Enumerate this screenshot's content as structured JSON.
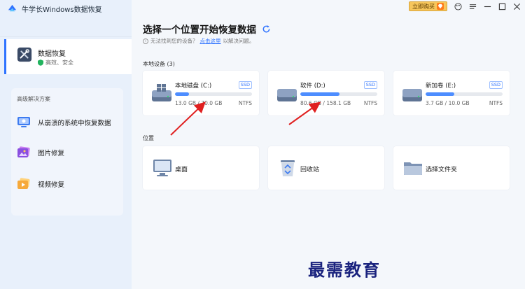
{
  "app": {
    "title": "牛学长Windows数据恢复"
  },
  "sidebar": {
    "active_item": {
      "label": "数据恢复",
      "sub": "高效、安全"
    },
    "advanced": {
      "title": "高级解决方案",
      "items": [
        {
          "label": "从崩溃的系统中恢复数据",
          "icon": "monitor-rescue-icon"
        },
        {
          "label": "图片修复",
          "icon": "photo-repair-icon"
        },
        {
          "label": "视频修复",
          "icon": "video-repair-icon"
        }
      ]
    }
  },
  "titlebar": {
    "buy_label": "立即购买"
  },
  "main": {
    "title": "选择一个位置开始恢复数据",
    "hint_prefix": "无法找到您的设备？",
    "hint_link": "点击这里",
    "hint_suffix": "以解决问题。",
    "devices_label": "本地设备 (3)",
    "devices": [
      {
        "name": "本地磁盘 (C:)",
        "badge": "SSD",
        "size": "13.0 GB / 70.0 GB",
        "fs": "NTFS",
        "used": 0.186
      },
      {
        "name": "软件 (D:)",
        "badge": "SSD",
        "size": "80.6 GB / 158.1 GB",
        "fs": "NTFS",
        "used": 0.51
      },
      {
        "name": "新加卷 (E:)",
        "badge": "SSD",
        "size": "3.7 GB / 10.0 GB",
        "fs": "NTFS",
        "used": 0.37
      }
    ],
    "locations_label": "位置",
    "locations": [
      {
        "label": "桌面",
        "icon": "desktop-icon"
      },
      {
        "label": "回收站",
        "icon": "recycle-bin-icon"
      },
      {
        "label": "选择文件夹",
        "icon": "folder-icon"
      }
    ]
  },
  "watermark": "最需教育",
  "colors": {
    "accent": "#2f73ff",
    "bar": "#4d8dff",
    "sidebar": "#e8f0fb",
    "arrow": "#e02020"
  }
}
